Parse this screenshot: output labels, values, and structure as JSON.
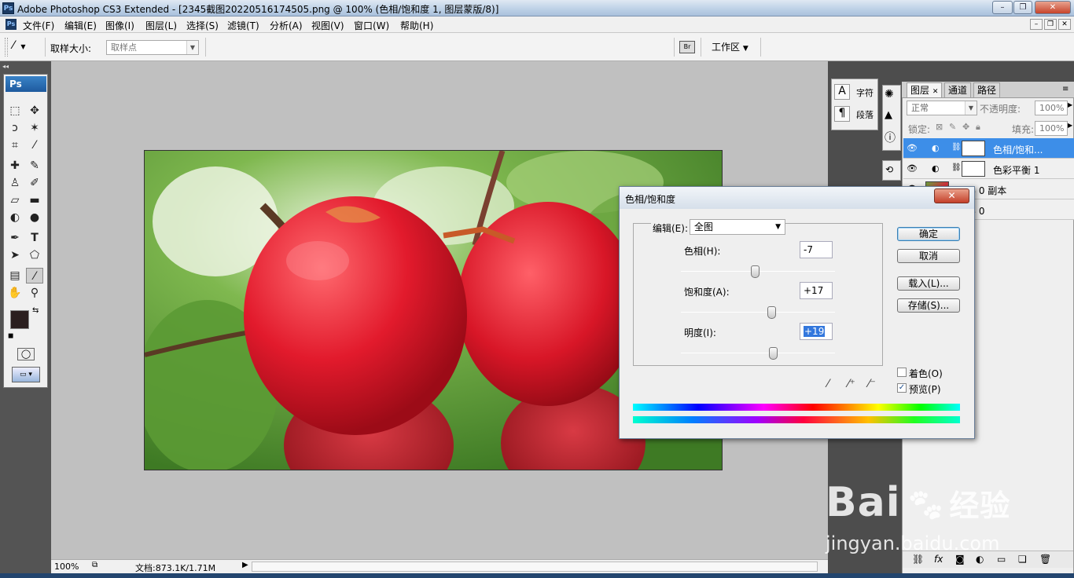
{
  "window": {
    "title": "Adobe Photoshop CS3 Extended - [2345截图20220516174505.png @ 100% (色相/饱和度 1, 图层蒙版/8)]",
    "logo": "Ps"
  },
  "menu": [
    "文件(F)",
    "编辑(E)",
    "图像(I)",
    "图层(L)",
    "选择(S)",
    "滤镜(T)",
    "分析(A)",
    "视图(V)",
    "窗口(W)",
    "帮助(H)"
  ],
  "options": {
    "sample_size_label": "取样大小:",
    "sample_size_value": "取样点",
    "workspace": "工作区"
  },
  "toolbox": {
    "logo": "Ps"
  },
  "status": {
    "zoom": "100%",
    "doc": "文档:873.1K/1.71M"
  },
  "char_panel": {
    "char": "字符",
    "para": "段落"
  },
  "layers_panel": {
    "tabs": [
      "图层",
      "通道",
      "路径"
    ],
    "blend_mode": "正常",
    "opacity_label": "不透明度:",
    "opacity": "100%",
    "lock_label": "锁定:",
    "fill_label": "填充:",
    "fill": "100%",
    "layers": [
      {
        "name": "色相/饱和...",
        "selected": true
      },
      {
        "name": "色彩平衡 1",
        "selected": false
      },
      {
        "name": "图层 0 副本",
        "selected": false
      },
      {
        "name": "图层 0",
        "selected": false
      }
    ]
  },
  "dialog": {
    "title": "色相/饱和度",
    "edit_label": "编辑(E):",
    "edit_value": "全图",
    "hue_label": "色相(H):",
    "hue": "-7",
    "hue_level": -7,
    "sat_label": "饱和度(A):",
    "sat": "+17",
    "sat_level": 17,
    "light_label": "明度(I):",
    "light": "+19",
    "light_level": 19,
    "ok": "确定",
    "cancel": "取消",
    "load": "载入(L)...",
    "save": "存储(S)...",
    "colorize": "着色(O)",
    "preview": "预览(P)"
  },
  "watermark": {
    "brand": "Bai",
    "brand2": "经验",
    "url": "jingyan.baidu.com"
  }
}
